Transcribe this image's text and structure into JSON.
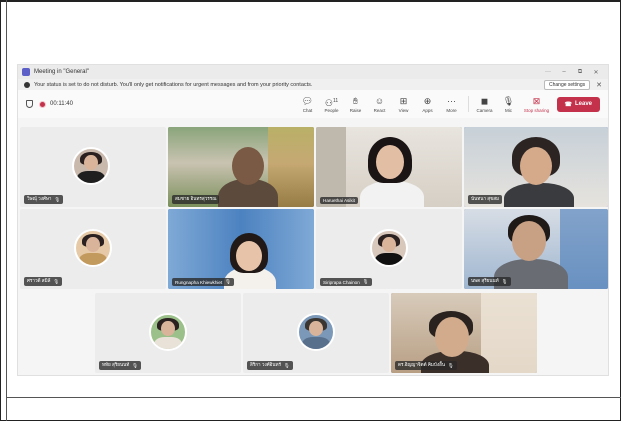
{
  "window": {
    "title": "Meeting in \"General\"",
    "controls": [
      "···",
      "–",
      "⧉",
      "✕"
    ]
  },
  "banner": {
    "message": "Your status is set to do not disturb. You'll only get notifications for urgent messages and from your priority contacts.",
    "settings_label": "Change settings"
  },
  "toolbar": {
    "timer": "00:11:40",
    "tools": [
      {
        "label": "Chat",
        "icon": "chat-icon"
      },
      {
        "label": "People",
        "icon": "people-icon",
        "count": "11"
      },
      {
        "label": "Raise",
        "icon": "raise-hand-icon"
      },
      {
        "label": "React",
        "icon": "react-icon"
      },
      {
        "label": "View",
        "icon": "view-icon"
      },
      {
        "label": "Apps",
        "icon": "apps-icon"
      },
      {
        "label": "More",
        "icon": "more-icon"
      }
    ],
    "camera_label": "Camera",
    "mic_label": "Mic",
    "stop_label": "Stop sharing",
    "leave_label": "Leave"
  },
  "participants": [
    {
      "name": "วิษณุ์ วงศ์ษา",
      "kind": "avatar"
    },
    {
      "name": "สมชาย อินทรสุวรรณ",
      "kind": "video"
    },
    {
      "name": "Haruethai Asikit",
      "kind": "video"
    },
    {
      "name": "นันทนา สุขสม",
      "kind": "video"
    },
    {
      "name": "ศราวดี สมิลี",
      "kind": "avatar"
    },
    {
      "name": "Rungnapha Khiewkhiet",
      "kind": "video"
    },
    {
      "name": "Siriprapa Chainon",
      "kind": "avatar"
    },
    {
      "name": "นพด สุริยนนท์",
      "kind": "video"
    },
    {
      "name": "หทัย สุริยนนท์",
      "kind": "avatar"
    },
    {
      "name": "สิริกา วงศ์อินทร์",
      "kind": "avatar"
    },
    {
      "name": "ดร.อิญญาจิตต์ คิมบังอื้น",
      "kind": "video"
    }
  ],
  "colors": {
    "accent": "#5b5fc7",
    "leave": "#c4314b",
    "active_speaker": "#7f85f5"
  }
}
